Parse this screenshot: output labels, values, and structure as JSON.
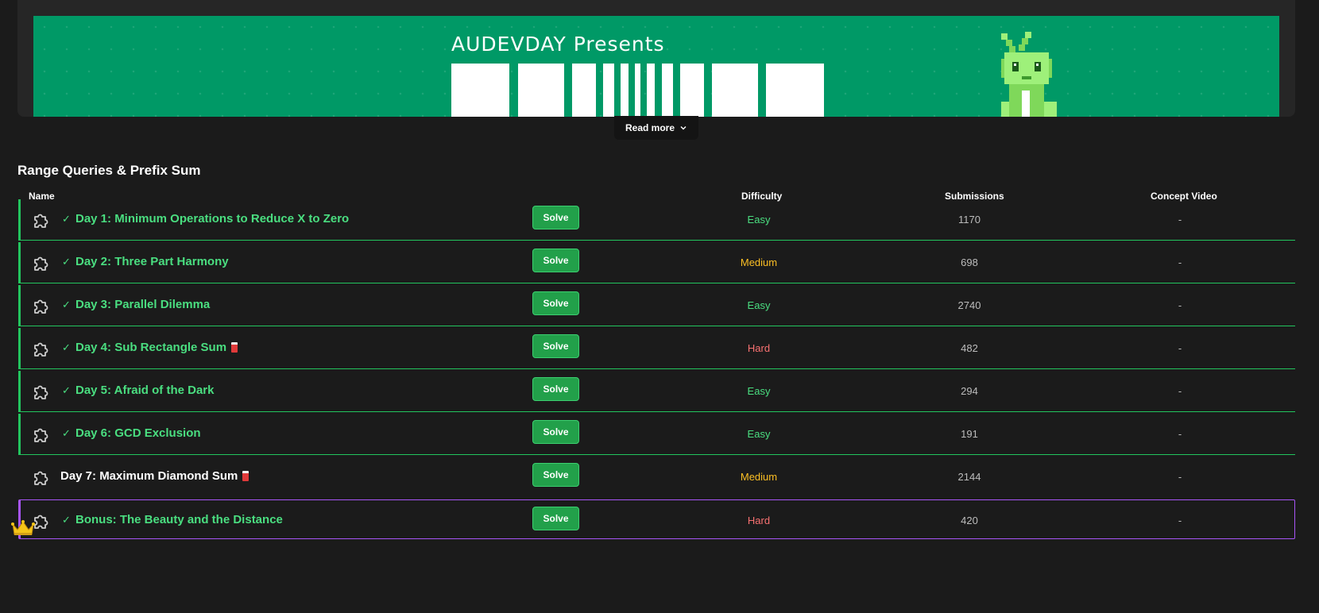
{
  "banner": {
    "title": "AUDEVDAY Presents",
    "bg_color": "#009966"
  },
  "read_more": {
    "label": "Read more",
    "icon": "chevron-down-icon"
  },
  "section": {
    "title": "Range Queries & Prefix Sum"
  },
  "columns": {
    "name": "Name",
    "difficulty": "Difficulty",
    "submissions": "Submissions",
    "concept_video": "Concept Video"
  },
  "colors": {
    "accent_green": "#22c55e",
    "easy": "#4ade80",
    "medium": "#fbbf24",
    "hard": "#f87171",
    "bonus_border": "#a855f7"
  },
  "problems": [
    {
      "title": "Day 1: Minimum Operations to Reduce X to Zero",
      "solve_label": "Solve",
      "difficulty": "Easy",
      "submissions": "1170",
      "video": "-",
      "solved": true
    },
    {
      "title": "Day 2: Three Part Harmony",
      "solve_label": "Solve",
      "difficulty": "Medium",
      "submissions": "698",
      "video": "-",
      "solved": true
    },
    {
      "title": "Day 3: Parallel Dilemma",
      "solve_label": "Solve",
      "difficulty": "Easy",
      "submissions": "2740",
      "video": "-",
      "solved": true
    },
    {
      "title": "Day 4: Sub Rectangle Sum",
      "solve_label": "Solve",
      "difficulty": "Hard",
      "submissions": "482",
      "video": "-",
      "solved": true
    },
    {
      "title": "Day 5: Afraid of the Dark",
      "solve_label": "Solve",
      "difficulty": "Easy",
      "submissions": "294",
      "video": "-",
      "solved": true
    },
    {
      "title": "Day 6: GCD Exclusion",
      "solve_label": "Solve",
      "difficulty": "Easy",
      "submissions": "191",
      "video": "-",
      "solved": true
    },
    {
      "title": "Day 7: Maximum Diamond Sum",
      "solve_label": "Solve",
      "difficulty": "Medium",
      "submissions": "2144",
      "video": "-",
      "solved": false
    },
    {
      "title": "Bonus: The Beauty and the Distance",
      "solve_label": "Solve",
      "difficulty": "Hard",
      "submissions": "420",
      "video": "-",
      "solved": true
    }
  ]
}
